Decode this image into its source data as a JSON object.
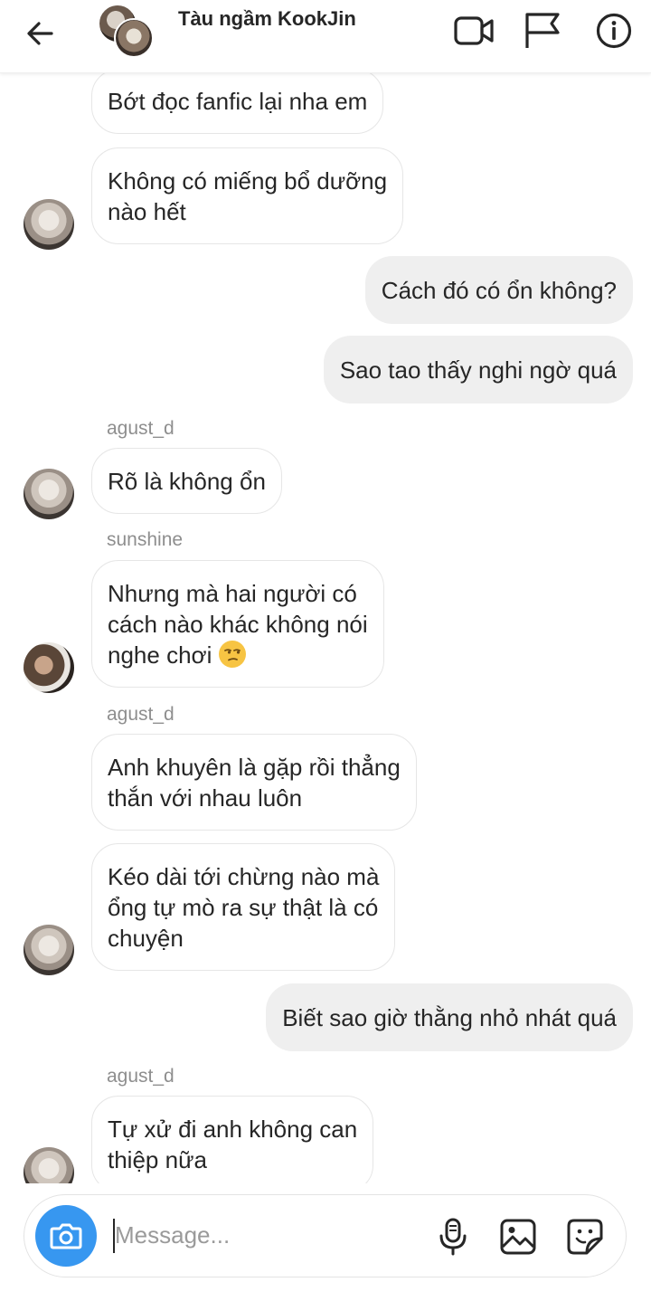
{
  "header": {
    "title": "Tàu ngầm KookJin"
  },
  "messages": [
    {
      "kind": "in",
      "text": "Bớt đọc fanfic lại nha em"
    },
    {
      "kind": "in",
      "lines": [
        "Không có miếng bổ dưỡng",
        "nào hết"
      ]
    },
    {
      "kind": "out",
      "text": "Cách đó có ổn không?"
    },
    {
      "kind": "out",
      "text": "Sao tao thấy nghi ngờ quá"
    },
    {
      "kind": "sender",
      "text": "agust_d"
    },
    {
      "kind": "in",
      "text": "Rõ là không ổn"
    },
    {
      "kind": "sender",
      "text": "sunshine"
    },
    {
      "kind": "in",
      "lines": [
        "Nhưng mà hai người có",
        "cách nào khác không nói",
        "nghe chơi"
      ],
      "emoji": "unamused-face"
    },
    {
      "kind": "sender",
      "text": "agust_d"
    },
    {
      "kind": "in",
      "lines": [
        "Anh khuyên là gặp rồi thẳng",
        "thắn với nhau luôn"
      ]
    },
    {
      "kind": "in",
      "lines": [
        "Kéo dài tới chừng nào mà",
        "ổng tự mò ra sự thật là có",
        "chuyện"
      ]
    },
    {
      "kind": "out",
      "text": "Biết sao giờ thằng nhỏ nhát quá"
    },
    {
      "kind": "sender",
      "text": "agust_d"
    },
    {
      "kind": "in",
      "lines": [
        "Tự xử đi anh không can",
        "thiệp  nữa"
      ]
    }
  ],
  "composer": {
    "placeholder": "Message..."
  },
  "colors": {
    "accent": "#3797f0",
    "outgoing_bubble": "#efefef",
    "incoming_border": "#e6e6e6",
    "sender_name": "#8e8e8e",
    "emoji_yellow": "#f7c443"
  },
  "icons": {
    "back": "arrow-left-icon",
    "video": "video-camera-icon",
    "report": "flag-icon",
    "info": "info-icon",
    "camera": "camera-icon",
    "mic": "microphone-icon",
    "gallery": "image-icon",
    "sticker": "sticker-icon"
  }
}
